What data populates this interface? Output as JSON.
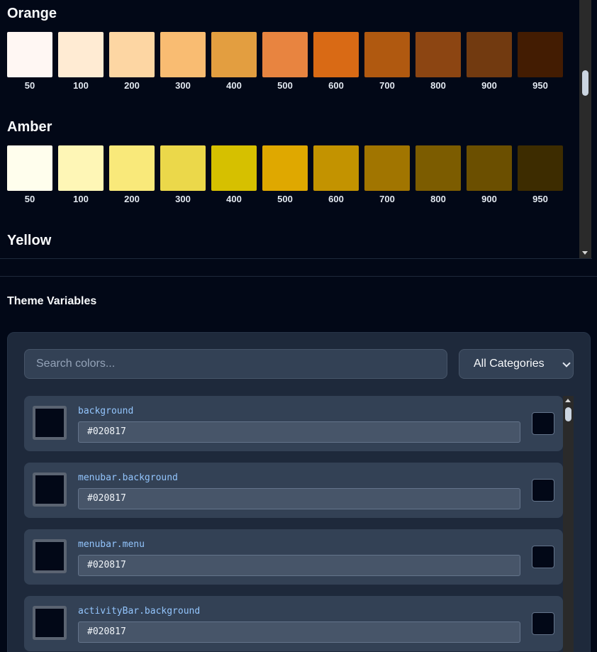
{
  "palette": {
    "groups": [
      {
        "name": "Orange",
        "swatches": [
          {
            "label": "50",
            "color": "#fff7f3"
          },
          {
            "label": "100",
            "color": "#ffebd3"
          },
          {
            "label": "200",
            "color": "#fdd6a3"
          },
          {
            "label": "300",
            "color": "#f9bc72"
          },
          {
            "label": "400",
            "color": "#e39e40"
          },
          {
            "label": "500",
            "color": "#e88440"
          },
          {
            "label": "600",
            "color": "#d96a15"
          },
          {
            "label": "700",
            "color": "#b05910"
          },
          {
            "label": "800",
            "color": "#8c4512"
          },
          {
            "label": "900",
            "color": "#723a10"
          },
          {
            "label": "950",
            "color": "#431c02"
          }
        ]
      },
      {
        "name": "Amber",
        "swatches": [
          {
            "label": "50",
            "color": "#fffeed"
          },
          {
            "label": "100",
            "color": "#fef6b6"
          },
          {
            "label": "200",
            "color": "#f9e97a"
          },
          {
            "label": "300",
            "color": "#ebd84a"
          },
          {
            "label": "400",
            "color": "#d6c000"
          },
          {
            "label": "500",
            "color": "#dfa800"
          },
          {
            "label": "600",
            "color": "#c39300"
          },
          {
            "label": "700",
            "color": "#a17500"
          },
          {
            "label": "800",
            "color": "#7c5c00"
          },
          {
            "label": "900",
            "color": "#6b4f00"
          },
          {
            "label": "950",
            "color": "#3d2c00"
          }
        ]
      },
      {
        "name": "Yellow",
        "swatches": []
      }
    ]
  },
  "theme": {
    "title": "Theme Variables",
    "search_placeholder": "Search colors...",
    "category_selected": "All Categories",
    "variables": [
      {
        "name": "background",
        "value": "#020817",
        "color": "#020817"
      },
      {
        "name": "menubar.background",
        "value": "#020817",
        "color": "#020817"
      },
      {
        "name": "menubar.menu",
        "value": "#020817",
        "color": "#020817"
      },
      {
        "name": "activityBar.background",
        "value": "#020817",
        "color": "#020817"
      }
    ]
  },
  "colors": {
    "page_bg": "#020817",
    "panel_bg": "#1e293b",
    "card_bg": "#334155",
    "var_name": "#93c5fd"
  }
}
